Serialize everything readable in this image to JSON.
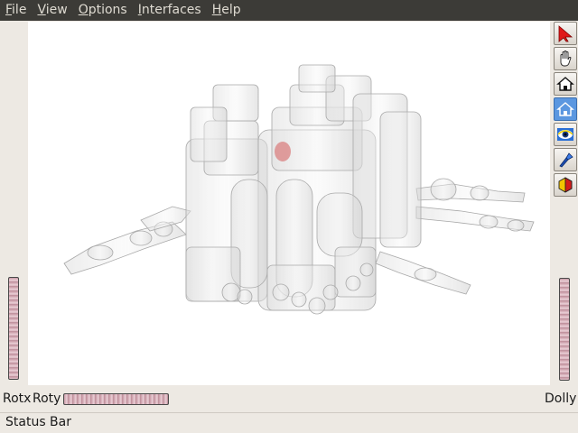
{
  "menubar": {
    "items": [
      {
        "label": "File"
      },
      {
        "label": "View"
      },
      {
        "label": "Options"
      },
      {
        "label": "Interfaces"
      },
      {
        "label": "Help"
      }
    ]
  },
  "toolbar": {
    "buttons": [
      {
        "icon": "arrow-pointer-icon",
        "label": "Select"
      },
      {
        "icon": "hand-icon",
        "label": "View"
      },
      {
        "icon": "home-icon",
        "label": "Home"
      },
      {
        "icon": "set-home-icon",
        "label": "Set Home"
      },
      {
        "icon": "eye-icon",
        "label": "View All"
      },
      {
        "icon": "seek-flashlight-icon",
        "label": "Seek"
      },
      {
        "icon": "projection-cube-icon",
        "label": "Projection"
      }
    ],
    "active_index": 3
  },
  "viewer": {
    "scene": "translucent robot model (wireframe render)",
    "highlight_color": "#d98080"
  },
  "bottom": {
    "rotx_label": "Rotx",
    "roty_label": "Roty",
    "dolly_label": "Dolly"
  },
  "status": {
    "text": "Status Bar"
  },
  "colors": {
    "menubar_bg": "#3c3b37",
    "menubar_text": "#dfdbd2",
    "window_bg": "#ede9e3",
    "wheel": "#c89aa6"
  }
}
